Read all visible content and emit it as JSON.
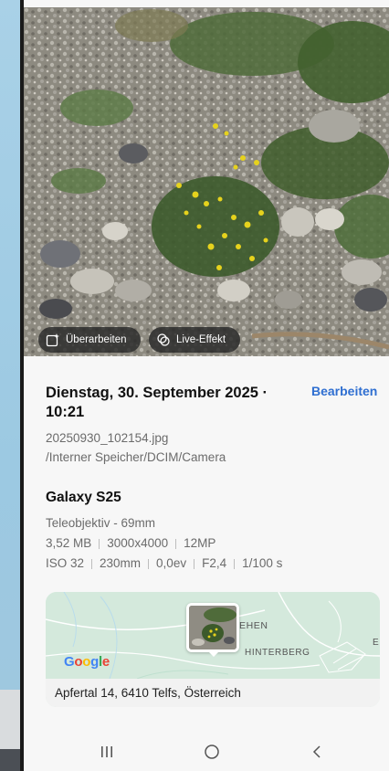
{
  "photo_actions": {
    "edit_label": "Überarbeiten",
    "live_effect_label": "Live-Effekt"
  },
  "details": {
    "date": "Dienstag, 30. September 2025 · 10:21",
    "edit_link": "Bearbeiten",
    "filename": "20250930_102154.jpg",
    "path": "/Interner Speicher/DCIM/Camera",
    "device": "Galaxy S25",
    "lens": "Teleobjektiv - 69mm",
    "specs": [
      "3,52 MB",
      "3000x4000",
      "12MP"
    ],
    "exif": [
      "ISO 32",
      "230mm",
      "0,0ev",
      "F2,4",
      "1/100 s"
    ]
  },
  "map": {
    "provider": "Google",
    "label_lehen": "EHEN",
    "label_hinterberg": "HINTERBERG",
    "label_edge": "E",
    "address": "Apfertal 14, 6410 Telfs, Österreich"
  },
  "colors": {
    "accent": "#2f6fd1",
    "background": "#f7f7f7",
    "desktop": "#8fc3e0"
  },
  "navigation": [
    "recent-apps-icon",
    "home-icon",
    "back-icon"
  ]
}
